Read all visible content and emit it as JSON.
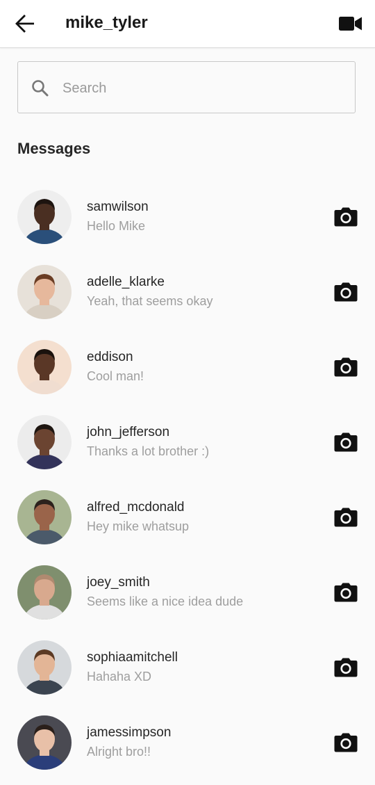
{
  "header": {
    "title": "mike_tyler",
    "back_icon": "arrow-left-icon",
    "video_icon": "video-camera-icon"
  },
  "search": {
    "placeholder": "Search",
    "value": "",
    "icon": "search-icon"
  },
  "section": {
    "title": "Messages"
  },
  "messages": [
    {
      "username": "samwilson",
      "preview": "Hello Mike",
      "avatar_bg": "#eeeeee",
      "skin": "#4a2f22",
      "hair": "#1d1410",
      "shirt": "#2a4f7a"
    },
    {
      "username": "adelle_klarke",
      "preview": "Yeah, that seems okay",
      "avatar_bg": "#e7e1d9",
      "skin": "#e6b89c",
      "hair": "#6a3d24",
      "shirt": "#d8cfc3"
    },
    {
      "username": "eddison",
      "preview": "Cool man!",
      "avatar_bg": "#f4dfcf",
      "skin": "#5a3726",
      "hair": "#1a120d",
      "shirt": "#f0ddd0"
    },
    {
      "username": "john_jefferson",
      "preview": "Thanks a lot brother :)",
      "avatar_bg": "#ececec",
      "skin": "#6b4431",
      "hair": "#1e1611",
      "shirt": "#33335a"
    },
    {
      "username": "alfred_mcdonald",
      "preview": "Hey mike whatsup",
      "avatar_bg": "#a8b592",
      "skin": "#9a644a",
      "hair": "#2c221d",
      "shirt": "#4b5a6a"
    },
    {
      "username": "joey_smith",
      "preview": "Seems like a nice idea dude",
      "avatar_bg": "#7f8f6e",
      "skin": "#d8a98e",
      "hair": "#b08a70",
      "shirt": "#e0e0e0"
    },
    {
      "username": "sophiaamitchell",
      "preview": "Hahaha XD",
      "avatar_bg": "#d6d9dc",
      "skin": "#e3b596",
      "hair": "#5c3a24",
      "shirt": "#3b4450"
    },
    {
      "username": "jamessimpson",
      "preview": "Alright bro!!",
      "avatar_bg": "#4a4a52",
      "skin": "#e8c0a8",
      "hair": "#2a1f1a",
      "shirt": "#2b3e7a"
    }
  ],
  "row_icon": "camera-icon"
}
